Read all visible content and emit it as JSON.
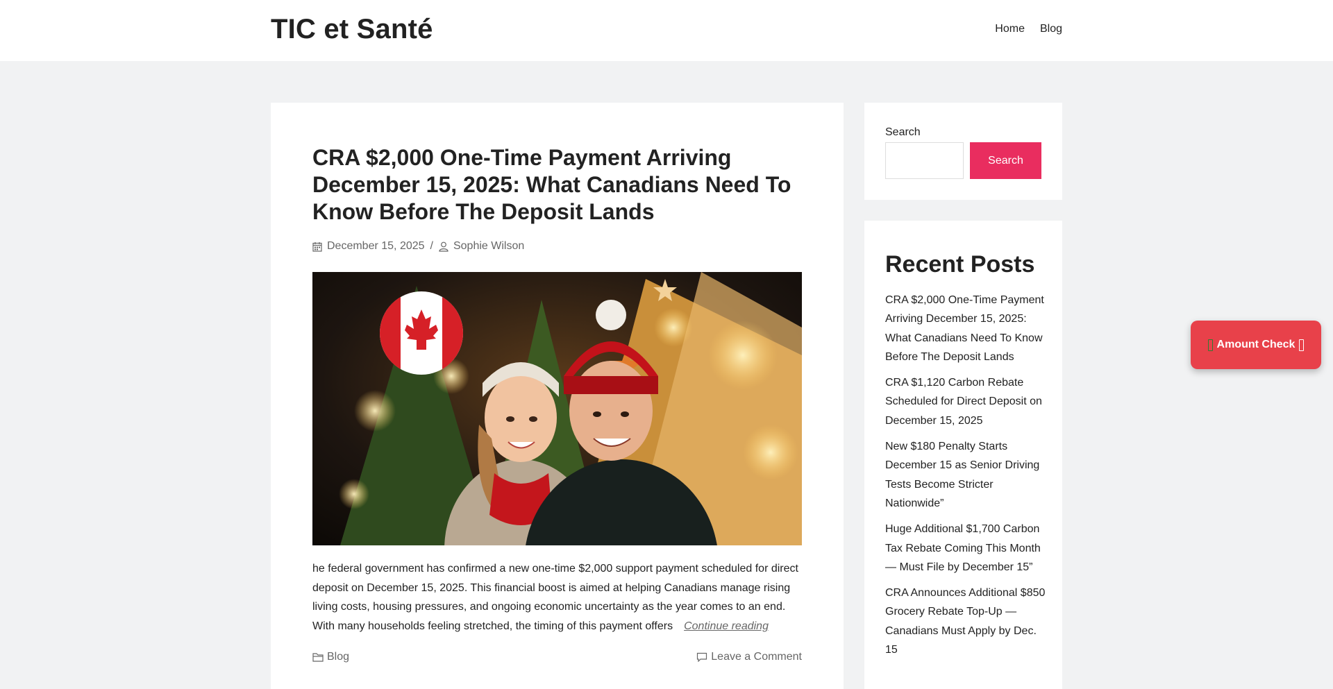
{
  "header": {
    "site_title": "TIC et Santé",
    "nav": [
      "Home",
      "Blog"
    ]
  },
  "post": {
    "title": "CRA $2,000 One-Time Payment Arriving December 15, 2025: What Canadians Need To Know Before The Deposit Lands",
    "date": "December 15, 2025",
    "separator": "/",
    "author": "Sophie Wilson",
    "excerpt": "he federal government has confirmed a new one-time $2,000 support payment scheduled for direct deposit on December 15, 2025. This financial boost is aimed at helping Canadians manage rising living costs, housing pressures, and ongoing economic uncertainty as the year comes to an end. With many households feeling stretched, the timing of this payment offers",
    "continue_label": "Continue reading",
    "category": "Blog",
    "comment_label": "Leave a Comment"
  },
  "sidebar": {
    "search_label": "Search",
    "search_value": "",
    "search_button": "Search",
    "recent_title": "Recent Posts",
    "recent_posts": [
      "CRA $2,000 One-Time Payment Arriving December 15, 2025: What Canadians Need To Know Before The Deposit Lands",
      "CRA $1,120 Carbon Rebate Scheduled for Direct Deposit on December 15, 2025",
      "New $180 Penalty Starts December 15 as Senior Driving Tests Become Stricter Nationwide”",
      "Huge Additional $1,700 Carbon Tax Rebate Coming This Month — Must File by December 15”",
      "CRA Announces Additional $850 Grocery Rebate Top-Up — Canadians Must Apply by Dec. 15"
    ]
  },
  "floating_button": {
    "label": "Amount Check"
  },
  "colors": {
    "accent": "#e92d5f",
    "floating_button": "#e8414a",
    "page_background": "#f1f2f3"
  },
  "icons": [
    "calendar-icon",
    "user-icon",
    "folder-icon",
    "comment-icon"
  ]
}
